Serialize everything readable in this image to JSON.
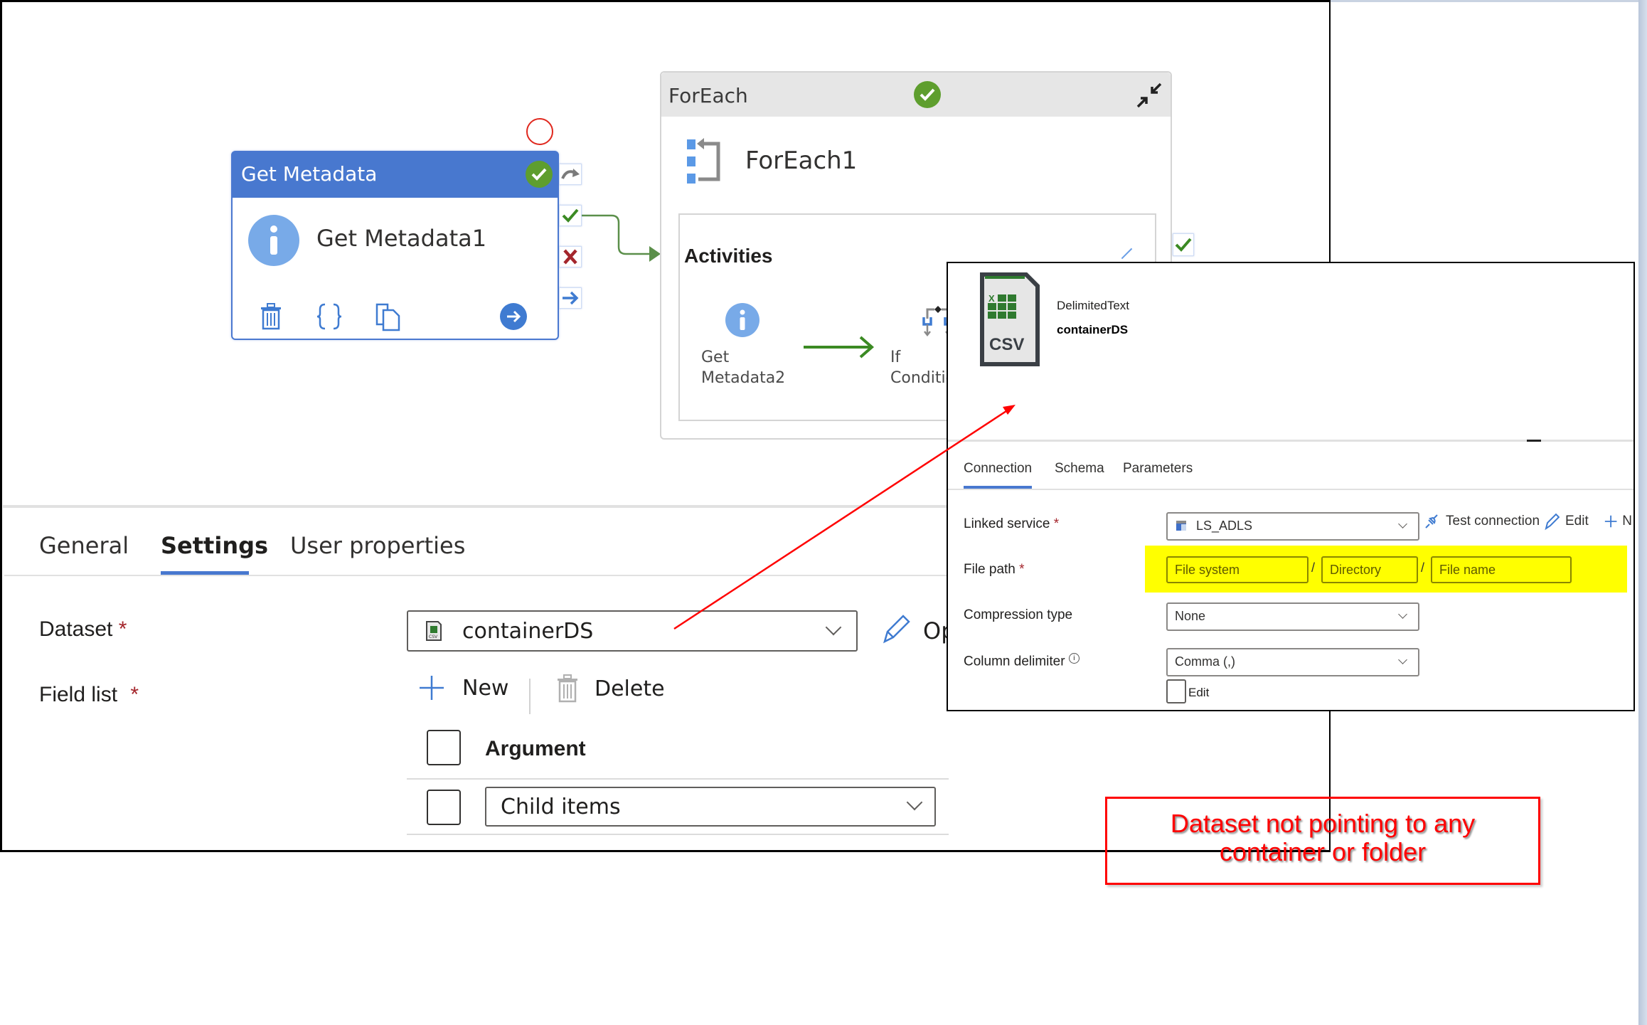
{
  "canvas": {
    "get_metadata_activity": {
      "type_label": "Get Metadata",
      "name": "Get Metadata1",
      "status": "succeeded",
      "actions": [
        "delete-icon",
        "code-icon",
        "copy-icon",
        "go-to-icon"
      ],
      "connectors": [
        "skipped",
        "success",
        "failure",
        "completion"
      ]
    },
    "foreach_activity": {
      "type_label": "ForEach",
      "name": "ForEach1",
      "status": "succeeded",
      "activities_label": "Activities",
      "inner_activities": [
        {
          "label_line1": "Get",
          "label_line2": "Metadata2",
          "icon": "info-icon"
        },
        {
          "label_line1": "If",
          "label_line2": "Conditio",
          "icon": "if-condition-icon"
        }
      ]
    }
  },
  "properties_panel": {
    "tabs": [
      {
        "label": "General",
        "active": false
      },
      {
        "label": "Settings",
        "active": true
      },
      {
        "label": "User properties",
        "active": false
      }
    ],
    "dataset": {
      "label": "Dataset",
      "required_mark": "*",
      "value": "containerDS",
      "open_label": "Op"
    },
    "field_list": {
      "label": "Field list",
      "required_mark": "*",
      "new_label": "New",
      "delete_label": "Delete",
      "column_header": "Argument",
      "rows": [
        {
          "value": "Child items"
        }
      ]
    }
  },
  "dataset_panel": {
    "type": "DelimitedText",
    "name": "containerDS",
    "file_icon_text": "CSV",
    "tabs": [
      {
        "label": "Connection",
        "active": true
      },
      {
        "label": "Schema",
        "active": false
      },
      {
        "label": "Parameters",
        "active": false
      }
    ],
    "linked_service": {
      "label": "Linked service",
      "required_mark": "*",
      "value": "LS_ADLS",
      "test_connection_label": "Test connection",
      "edit_label": "Edit",
      "new_label": "N"
    },
    "file_path": {
      "label": "File path",
      "required_mark": "*",
      "file_system_placeholder": "File system",
      "directory_placeholder": "Directory",
      "file_name_placeholder": "File name",
      "separator": "/"
    },
    "compression_type": {
      "label": "Compression type",
      "value": "None"
    },
    "column_delimiter": {
      "label": "Column delimiter",
      "value": "Comma (,)",
      "edit_label": "Edit"
    }
  },
  "annotation": {
    "note_line1": "Dataset not pointing to any",
    "note_line2": "container or folder",
    "color": "#ff0000",
    "highlight_color": "#ffff00"
  },
  "colors": {
    "accent": "#4878cf",
    "success": "#5e9e2e",
    "failure": "#a4262c",
    "connector": "#5b8f4a"
  }
}
